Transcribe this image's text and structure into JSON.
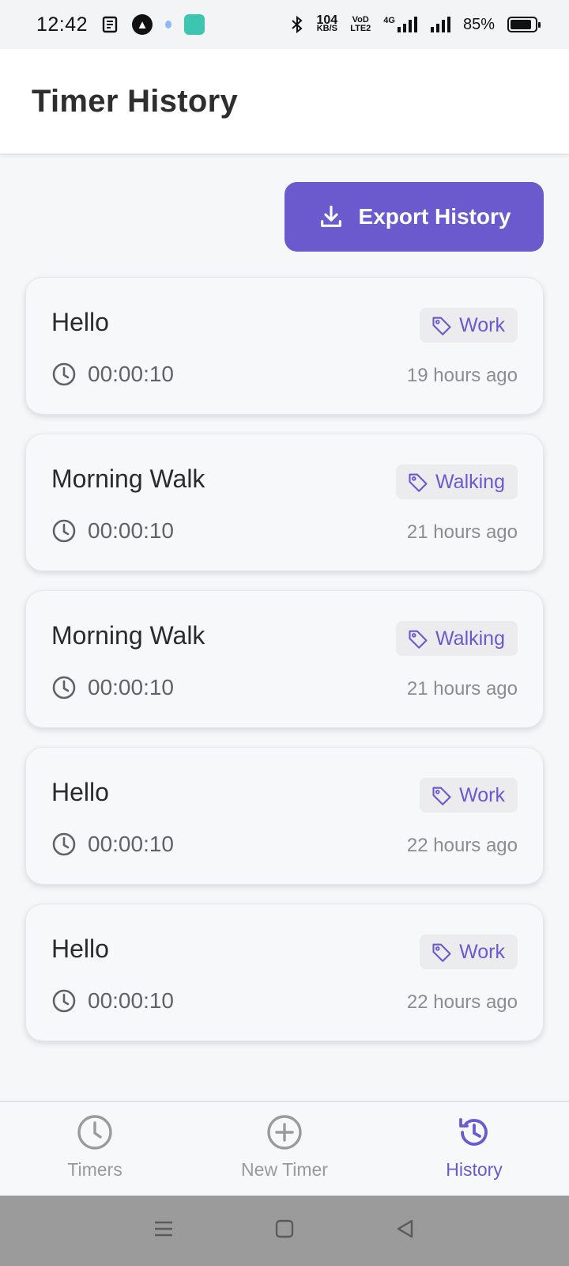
{
  "status_bar": {
    "time": "12:42",
    "net_speed_top": "104",
    "net_speed_bottom": "KB/S",
    "volte_top": "VoD",
    "volte_bottom": "LTE2",
    "network": "4G",
    "battery": "85%",
    "battery_level": 0.85
  },
  "header": {
    "title": "Timer History"
  },
  "export_button": {
    "label": "Export History",
    "icon": "download-icon"
  },
  "history": [
    {
      "name": "Hello",
      "tag": "Work",
      "duration": "00:00:10",
      "ago": "19 hours ago"
    },
    {
      "name": "Morning Walk",
      "tag": "Walking",
      "duration": "00:00:10",
      "ago": "21 hours ago"
    },
    {
      "name": "Morning Walk",
      "tag": "Walking",
      "duration": "00:00:10",
      "ago": "21 hours ago"
    },
    {
      "name": "Hello",
      "tag": "Work",
      "duration": "00:00:10",
      "ago": "22 hours ago"
    },
    {
      "name": "Hello",
      "tag": "Work",
      "duration": "00:00:10",
      "ago": "22 hours ago"
    }
  ],
  "bottom_nav": [
    {
      "label": "Timers",
      "icon": "clock-icon",
      "active": false
    },
    {
      "label": "New Timer",
      "icon": "plus-circle-icon",
      "active": false
    },
    {
      "label": "History",
      "icon": "history-icon",
      "active": true
    }
  ],
  "colors": {
    "accent": "#6a5acd",
    "background": "#f6f7f9",
    "card": "#f7f8fa"
  }
}
